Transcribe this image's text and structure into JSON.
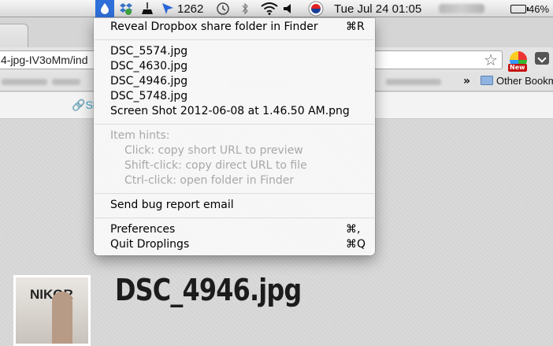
{
  "menubar": {
    "badge_count": "1262",
    "datetime": "Tue Jul 24  01:05",
    "battery": "46%"
  },
  "browser": {
    "url": "4-jpg-IV3oMm/ind",
    "other_bookmarks": "Other Bookm",
    "extension_badge": "New",
    "share_link": "Sh"
  },
  "page": {
    "file_title": "DSC_4946.jpg",
    "thumbnail_text": "NIKOR"
  },
  "menu": {
    "reveal": {
      "label": "Reveal Dropbox share folder in Finder",
      "shortcut": "⌘R"
    },
    "files": [
      "DSC_5574.jpg",
      "DSC_4630.jpg",
      "DSC_4946.jpg",
      "DSC_5748.jpg",
      "Screen Shot 2012-06-08 at 1.46.50 AM.png"
    ],
    "hints_title": "Item hints:",
    "hints": [
      "Click: copy short URL to preview",
      "Shift-click: copy direct URL to file",
      "Ctrl-click: open folder in Finder"
    ],
    "bug_report": "Send bug report email",
    "preferences": {
      "label": "Preferences",
      "shortcut": "⌘,"
    },
    "quit": {
      "label": "Quit Droplings",
      "shortcut": "⌘Q"
    }
  }
}
